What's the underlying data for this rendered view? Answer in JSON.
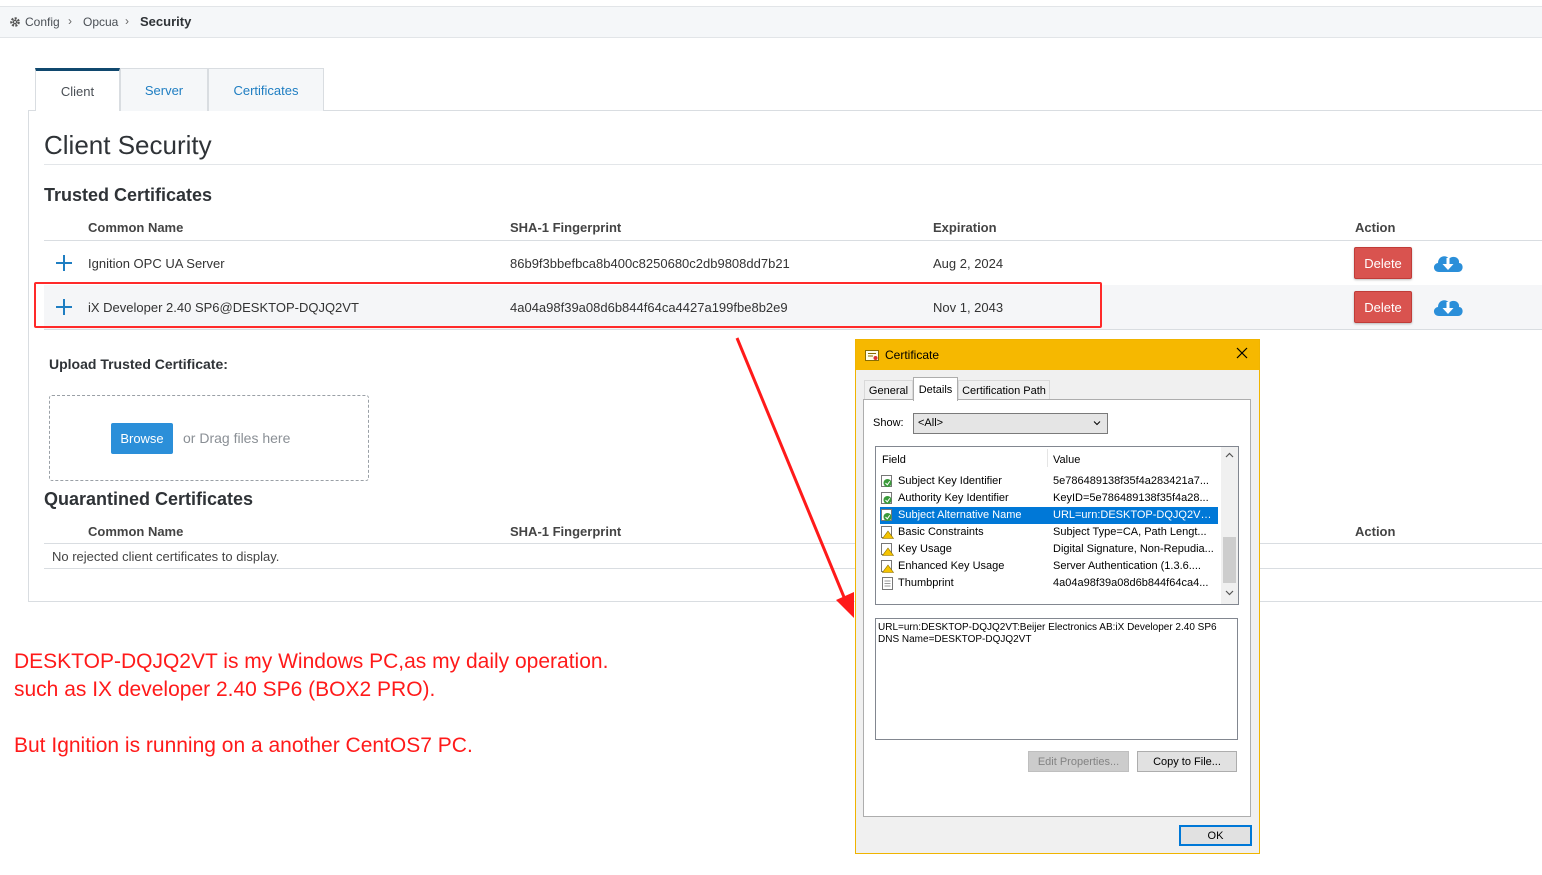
{
  "breadcrumb": {
    "items": [
      "Config",
      "Opcua"
    ],
    "current": "Security"
  },
  "tabs": [
    {
      "label": "Client",
      "active": true
    },
    {
      "label": "Server",
      "active": false
    },
    {
      "label": "Certificates",
      "active": false
    }
  ],
  "page_title": "Client Security",
  "trusted": {
    "title": "Trusted Certificates",
    "columns": {
      "name": "Common Name",
      "fingerprint": "SHA-1 Fingerprint",
      "expiration": "Expiration",
      "action": "Action"
    },
    "rows": [
      {
        "name": "Ignition OPC UA Server",
        "fingerprint": "86b9f3bbefbca8b400c8250680c2db9808dd7b21",
        "expiration": "Aug 2, 2024",
        "delete": "Delete"
      },
      {
        "name": "iX Developer 2.40 SP6@DESKTOP-DQJQ2VT",
        "fingerprint": "4a04a98f39a08d6b844f64ca4427a199fbe8b2e9",
        "expiration": "Nov 1, 2043",
        "delete": "Delete"
      }
    ]
  },
  "upload": {
    "label": "Upload Trusted Certificate:",
    "browse": "Browse",
    "drag_text": "or Drag files here"
  },
  "quarantined": {
    "title": "Quarantined Certificates",
    "columns": {
      "name": "Common Name",
      "fingerprint": "SHA-1 Fingerprint",
      "action": "Action"
    },
    "empty": "No rejected client certificates to display."
  },
  "annotation": {
    "line1": "DESKTOP-DQJQ2VT is my  Windows PC,as my daily operation.",
    "line2": "such as IX developer 2.40 SP6 (BOX2 PRO).",
    "line3": "But Ignition is running on a another CentOS7 PC.",
    "color": "#ff1a1a"
  },
  "dialog": {
    "title": "Certificate",
    "tabs": [
      "General",
      "Details",
      "Certification Path"
    ],
    "show_label": "Show:",
    "show_value": "<All>",
    "list_headers": {
      "field": "Field",
      "value": "Value"
    },
    "list_rows": [
      {
        "field": "Subject Key Identifier",
        "value": "5e786489138f35f4a283421a7...",
        "icon": "cert-ext-icon"
      },
      {
        "field": "Authority Key Identifier",
        "value": "KeyID=5e786489138f35f4a28...",
        "icon": "cert-ext-icon"
      },
      {
        "field": "Subject Alternative Name",
        "value": "URL=urn:DESKTOP-DQJQ2VT:...",
        "icon": "cert-ext-icon",
        "selected": true
      },
      {
        "field": "Basic Constraints",
        "value": "Subject Type=CA, Path Lengt...",
        "icon": "cert-warning-icon"
      },
      {
        "field": "Key Usage",
        "value": "Digital Signature, Non-Repudia...",
        "icon": "cert-warning-icon"
      },
      {
        "field": "Enhanced Key Usage",
        "value": "Server Authentication (1.3.6....",
        "icon": "cert-warning-icon"
      },
      {
        "field": "Thumbprint",
        "value": "4a04a98f39a08d6b844f64ca4...",
        "icon": "cert-doc-icon"
      }
    ],
    "detail_line1": "URL=urn:DESKTOP-DQJQ2VT:Beijer Electronics AB:iX Developer 2.40 SP6",
    "detail_line2": "DNS Name=DESKTOP-DQJQ2VT",
    "edit_button": "Edit Properties...",
    "copy_button": "Copy to File...",
    "ok_button": "OK"
  },
  "colors": {
    "accent": "#1f7ec2",
    "delete": "#d9534f",
    "highlight": "#ff2a2a",
    "dialog_title": "#f6b800"
  }
}
